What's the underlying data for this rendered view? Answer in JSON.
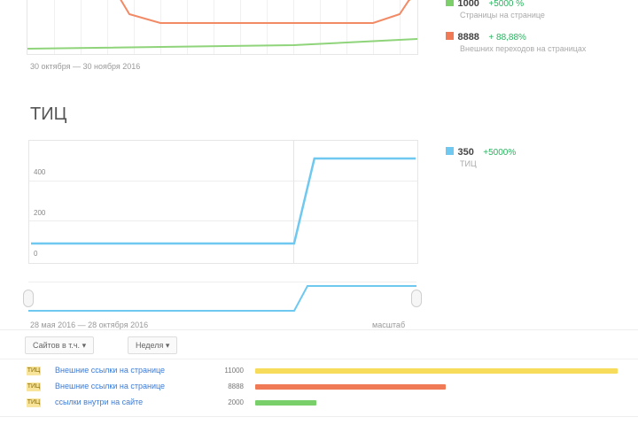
{
  "top_chart": {
    "date_range": "30 октября — 30 ноября 2016",
    "legend": [
      {
        "value": "1000",
        "delta": "+5000 %",
        "sub": "Страницы на странице",
        "color": "#7ccf6a"
      },
      {
        "value": "8888",
        "delta": "+ 88,88%",
        "sub": "Внешних переходов на страницах",
        "color": "#f07a55"
      }
    ]
  },
  "section2": {
    "title": "ТИЦ",
    "y_ticks": [
      "400",
      "200",
      "0"
    ],
    "date_range": "28 мая 2016 — 28 октября 2016",
    "zoom_label": "масштаб",
    "legend": {
      "value": "350",
      "delta": "+5000%",
      "sub": "ТИЦ",
      "color": "#6ec8ef"
    },
    "chart_data": {
      "type": "line",
      "series": [
        {
          "values": [
            0,
            0,
            0,
            0,
            0,
            0,
            0,
            0,
            0,
            0,
            0,
            0,
            0,
            0,
            400,
            400,
            400,
            400,
            400,
            400
          ]
        }
      ],
      "ylim": [
        0,
        450
      ]
    }
  },
  "controls": {
    "group_button": "Сайтов в т.ч.",
    "period_button": "Неделя"
  },
  "rows": [
    {
      "badge": "ТИЦ",
      "label": "Внешние ссылки на странице",
      "num": "11000",
      "fraction": 0.95,
      "color": "#f6dc5a"
    },
    {
      "badge": "ТИЦ",
      "label": "Внешние ссылки на странице",
      "num": "8888",
      "fraction": 0.5,
      "color": "#f07a55"
    },
    {
      "badge": "ТИЦ",
      "label": "ссылки внутри на сайте",
      "num": "2000",
      "fraction": 0.16,
      "color": "#79d06a"
    }
  ]
}
